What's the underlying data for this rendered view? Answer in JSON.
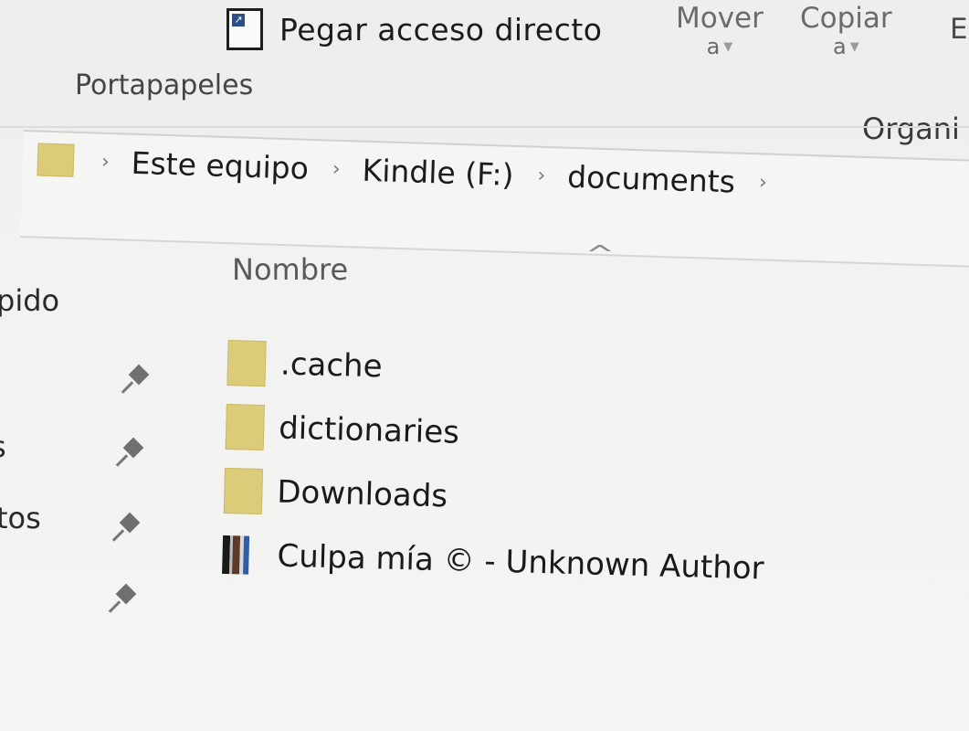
{
  "ribbon": {
    "paste_shortcut_label": "Pegar acceso directo",
    "group_label": "Portapapeles",
    "move_label": "Mover",
    "move_sub": "a",
    "copy_label": "Copiar",
    "copy_sub": "a",
    "edge_letter": "E",
    "organize_label": "Organi"
  },
  "address": {
    "crumbs": [
      "Este equipo",
      "Kindle (F:)",
      "documents"
    ]
  },
  "list": {
    "column_name": "Nombre",
    "items": [
      {
        "name": ".cache",
        "icon": "folder-icon"
      },
      {
        "name": "dictionaries",
        "icon": "folder-icon"
      },
      {
        "name": "Downloads",
        "icon": "folder-icon"
      },
      {
        "name": "Culpa mía © - Unknown Author",
        "icon": "book-icon"
      }
    ]
  },
  "nav": {
    "item1": "pido",
    "item2": "s",
    "item3": "tos"
  },
  "colors": {
    "folder": "#dccb78",
    "shortcut_arrow": "#2b4f86"
  }
}
